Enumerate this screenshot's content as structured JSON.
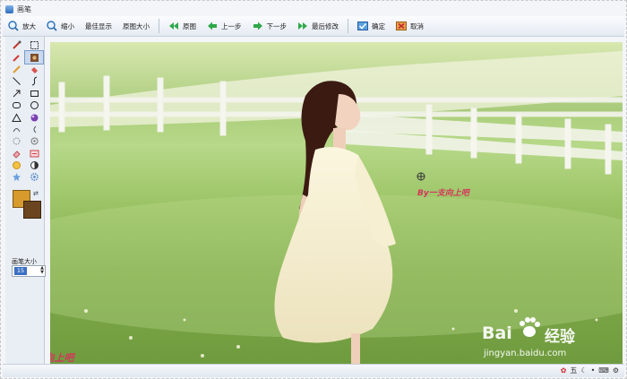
{
  "window": {
    "title": "画笔"
  },
  "toolbar": {
    "zoom_in": "放大",
    "zoom_out": "缩小",
    "best_fit": "最佳显示",
    "original_size": "原图大小",
    "original": "原图",
    "undo": "上一步",
    "redo": "下一步",
    "last_edit": "最后修改",
    "confirm": "确定",
    "cancel": "取消"
  },
  "left_panel": {
    "size_label": "画笔大小",
    "size_value": "15",
    "foreground_color": "#d79a2c",
    "background_color": "#6b4520"
  },
  "canvas": {
    "watermark_text": "By一支向上吧",
    "watermark_corner": "By一支向上吧"
  },
  "baidu": {
    "brand": "Bai",
    "brand_suffix": "经验",
    "url": "jingyan.baidu.com"
  },
  "statusbar": {
    "ime": "五"
  }
}
